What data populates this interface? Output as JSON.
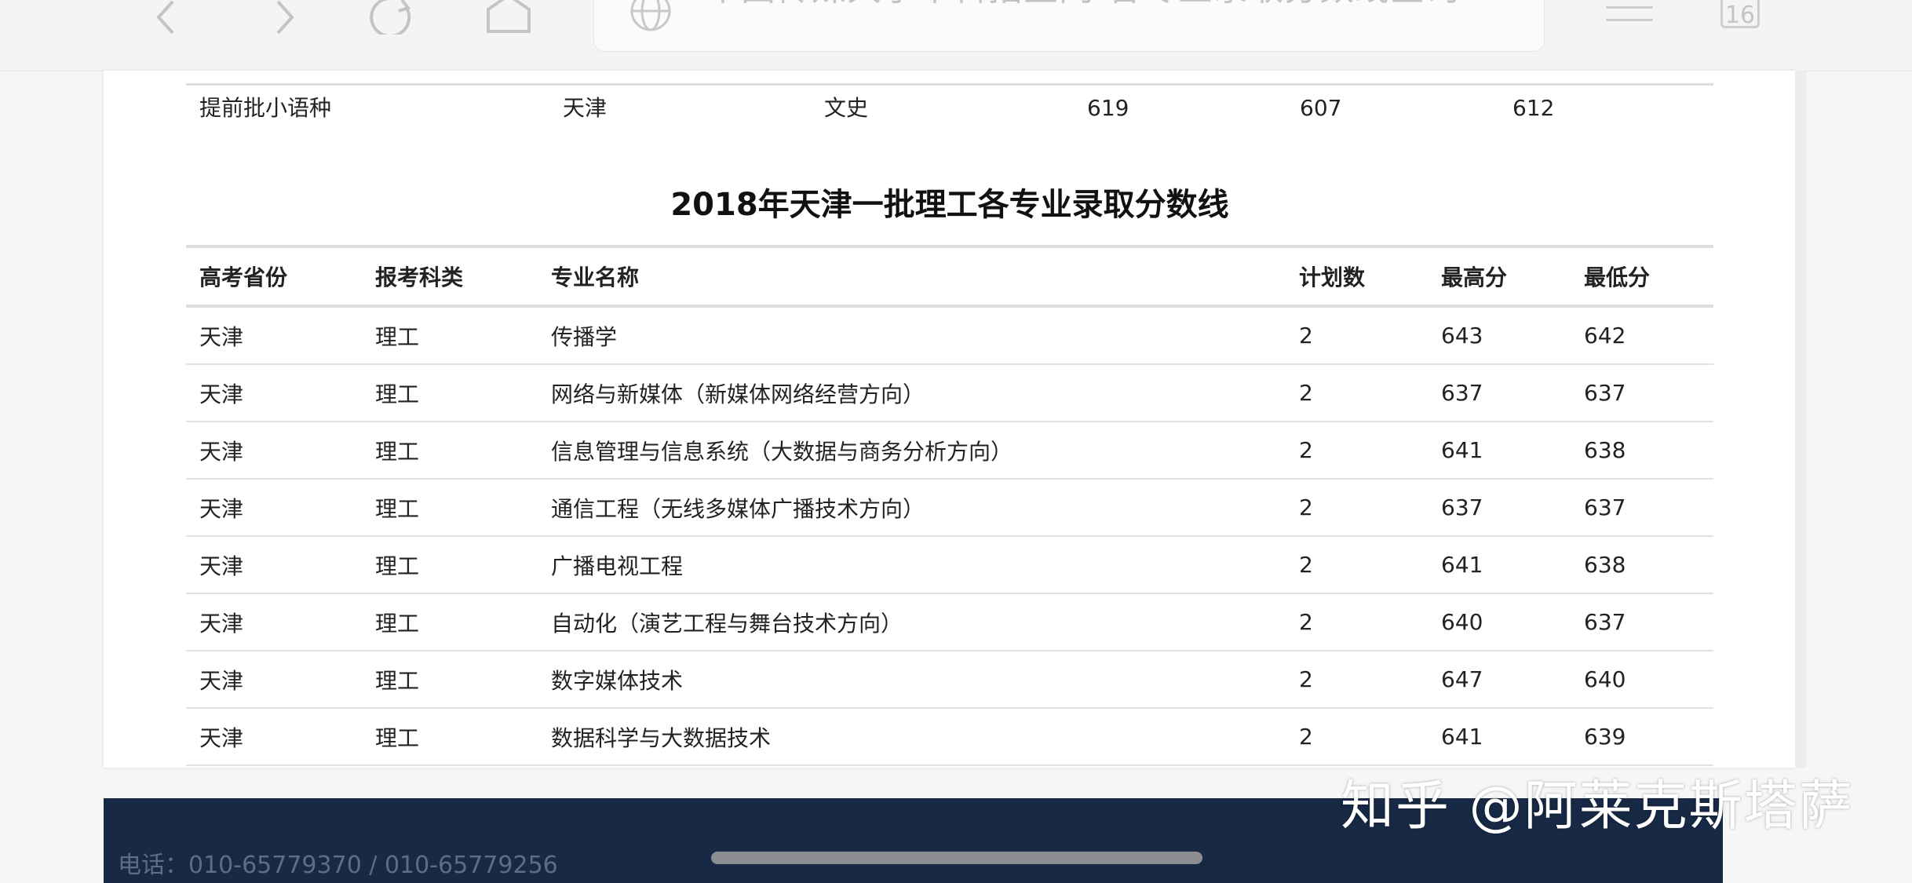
{
  "browser": {
    "url_title": "中国传媒大学本科招生网-各专业录取分数线查询",
    "tab_count": "16",
    "icons": [
      "back-icon",
      "forward-icon",
      "reload-icon",
      "home-icon",
      "globe-icon",
      "menu-icon",
      "tabs-icon"
    ]
  },
  "prev_table": {
    "last_row": [
      "提前批小语种",
      "天津",
      "文史",
      "619",
      "607",
      "612"
    ]
  },
  "section": {
    "title": "2018年天津一批理工各专业录取分数线"
  },
  "table": {
    "headers": [
      "高考省份",
      "报考科类",
      "专业名称",
      "计划数",
      "最高分",
      "最低分"
    ],
    "rows": [
      [
        "天津",
        "理工",
        "传播学",
        "2",
        "643",
        "642"
      ],
      [
        "天津",
        "理工",
        "网络与新媒体（新媒体网络经营方向）",
        "2",
        "637",
        "637"
      ],
      [
        "天津",
        "理工",
        "信息管理与信息系统（大数据与商务分析方向）",
        "2",
        "641",
        "638"
      ],
      [
        "天津",
        "理工",
        "通信工程（无线多媒体广播技术方向）",
        "2",
        "637",
        "637"
      ],
      [
        "天津",
        "理工",
        "广播电视工程",
        "2",
        "641",
        "638"
      ],
      [
        "天津",
        "理工",
        "自动化（演艺工程与舞台技术方向）",
        "2",
        "640",
        "637"
      ],
      [
        "天津",
        "理工",
        "数字媒体技术",
        "2",
        "647",
        "640"
      ],
      [
        "天津",
        "理工",
        "数据科学与大数据技术",
        "2",
        "641",
        "639"
      ]
    ]
  },
  "footer": {
    "phone": "电话：010-65779370 / 010-65779256"
  },
  "watermark": "知乎 @阿莱克斯塔萨",
  "colors": {
    "footer_bg": "#172945",
    "page_bg": "#f6f6f6"
  }
}
